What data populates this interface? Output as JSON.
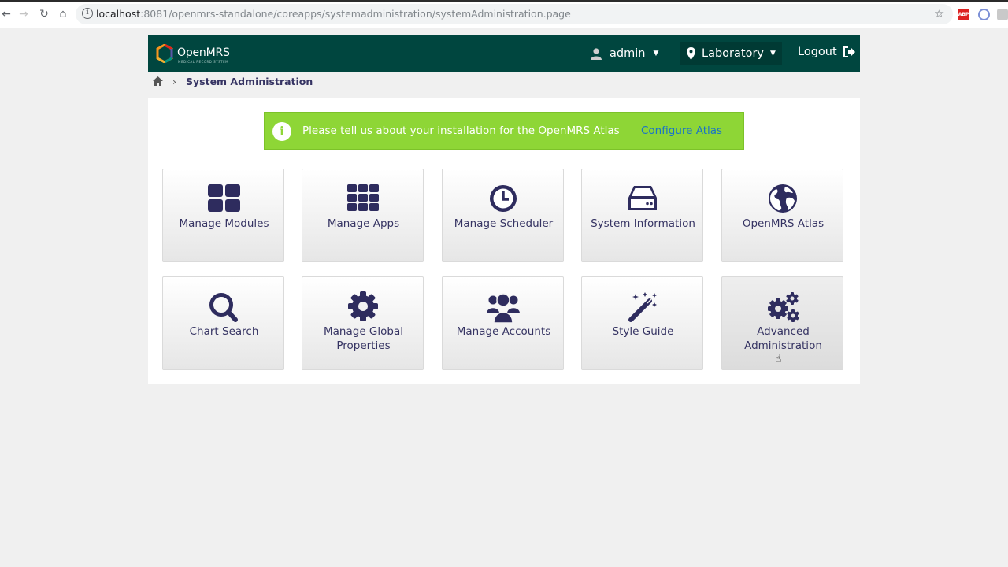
{
  "browser": {
    "url_host": "localhost",
    "url_rest": ":8081/openmrs-standalone/coreapps/systemadministration/systemAdministration.page"
  },
  "header": {
    "logo_text": "OpenMRS",
    "logo_subtitle": "MEDICAL RECORD SYSTEM",
    "user_label": "admin",
    "location_label": "Laboratory",
    "logout_label": "Logout"
  },
  "breadcrumb": {
    "current": "System Administration"
  },
  "banner": {
    "message": "Please tell us about your installation for the OpenMRS Atlas",
    "link_label": "Configure Atlas"
  },
  "tiles": [
    {
      "label": "Manage Modules",
      "icon": "grid-icon"
    },
    {
      "label": "Manage Apps",
      "icon": "apps-grid-icon"
    },
    {
      "label": "Manage Scheduler",
      "icon": "clock-icon"
    },
    {
      "label": "System Information",
      "icon": "hard-drive-icon"
    },
    {
      "label": "OpenMRS Atlas",
      "icon": "globe-icon"
    },
    {
      "label": "Chart Search",
      "icon": "search-icon"
    },
    {
      "label": "Manage Global Properties",
      "icon": "gear-icon"
    },
    {
      "label": "Manage Accounts",
      "icon": "users-icon"
    },
    {
      "label": "Style Guide",
      "icon": "magic-wand-icon"
    },
    {
      "label": "Advanced Administration",
      "icon": "gears-icon"
    }
  ],
  "colors": {
    "header_bg": "#00463f",
    "banner_bg": "#8ed636",
    "tile_text": "#363463",
    "link": "#1a73c8"
  }
}
